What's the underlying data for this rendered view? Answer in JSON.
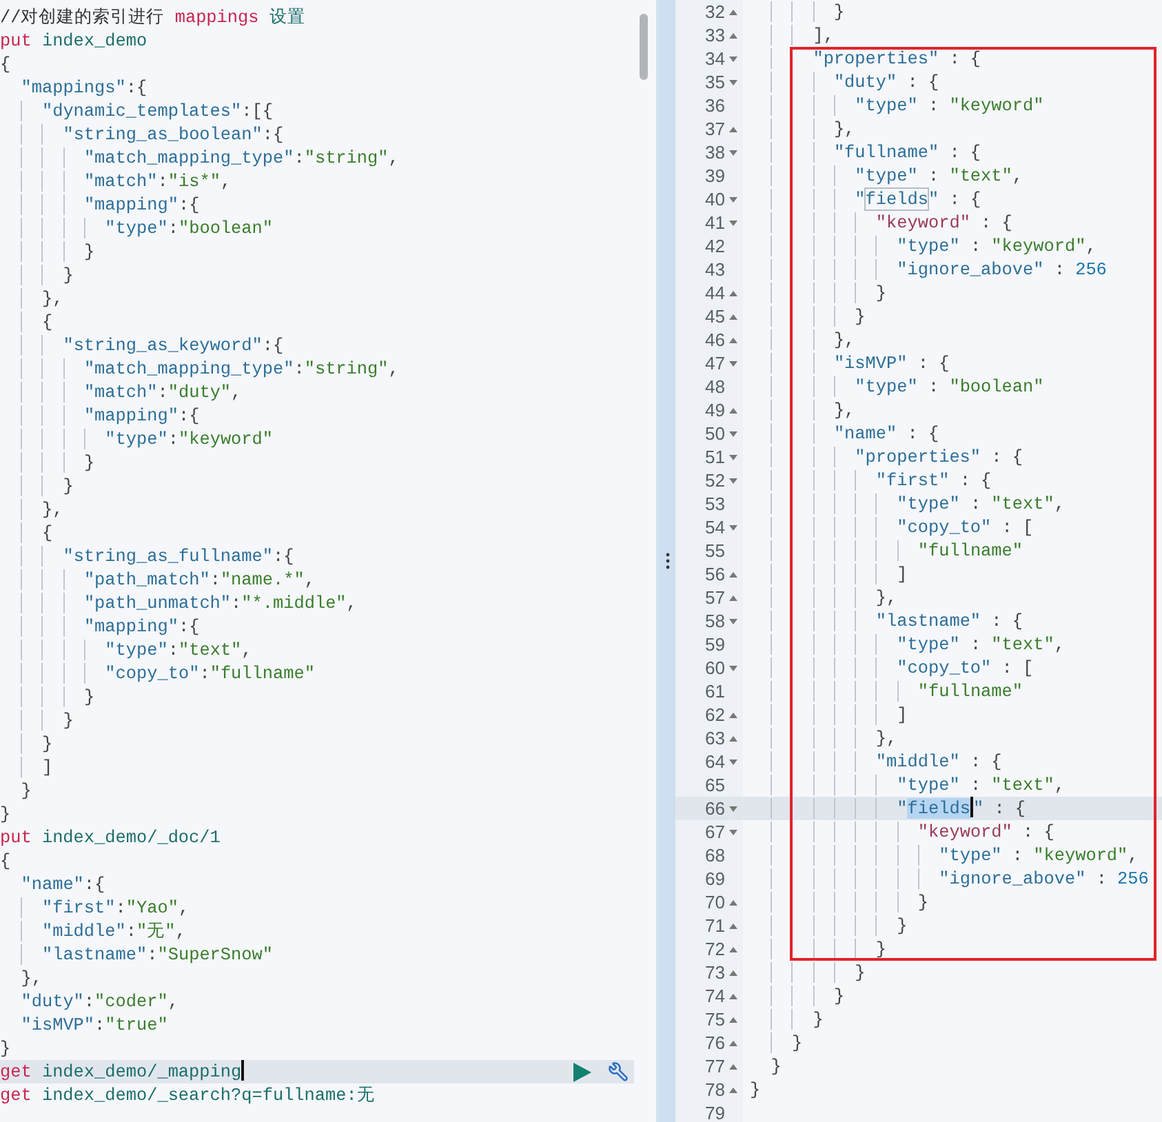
{
  "request_editor": {
    "lines": [
      {
        "active": false,
        "tokens": [
          {
            "kind": "comment",
            "text": "//对创建的索引进行 "
          },
          {
            "kind": "method",
            "text": "mappings"
          },
          {
            "kind": "path",
            "text": " 设置"
          }
        ]
      },
      {
        "active": false,
        "tokens": [
          {
            "kind": "method",
            "text": "put"
          },
          {
            "kind": "path",
            "text": " index_demo"
          }
        ]
      },
      {
        "active": false,
        "tokens": [
          {
            "kind": "punct",
            "text": "{"
          }
        ]
      },
      {
        "active": false,
        "tokens": [
          {
            "kind": "key",
            "text": "  \"mappings\""
          },
          {
            "kind": "punct",
            "text": ":{"
          }
        ]
      },
      {
        "active": false,
        "tokens": [
          {
            "kind": "key",
            "text": "    \"dynamic_templates\""
          },
          {
            "kind": "punct",
            "text": ":[{"
          }
        ]
      },
      {
        "active": false,
        "tokens": [
          {
            "kind": "key",
            "text": "      \"string_as_boolean\""
          },
          {
            "kind": "punct",
            "text": ":{"
          }
        ]
      },
      {
        "active": false,
        "tokens": [
          {
            "kind": "key",
            "text": "        \"match_mapping_type\""
          },
          {
            "kind": "punct",
            "text": ":"
          },
          {
            "kind": "string",
            "text": "\"string\""
          },
          {
            "kind": "punct",
            "text": ","
          }
        ]
      },
      {
        "active": false,
        "tokens": [
          {
            "kind": "key",
            "text": "        \"match\""
          },
          {
            "kind": "punct",
            "text": ":"
          },
          {
            "kind": "string",
            "text": "\"is*\""
          },
          {
            "kind": "punct",
            "text": ","
          }
        ]
      },
      {
        "active": false,
        "tokens": [
          {
            "kind": "key",
            "text": "        \"mapping\""
          },
          {
            "kind": "punct",
            "text": ":{"
          }
        ]
      },
      {
        "active": false,
        "tokens": [
          {
            "kind": "key",
            "text": "          \"type\""
          },
          {
            "kind": "punct",
            "text": ":"
          },
          {
            "kind": "string",
            "text": "\"boolean\""
          }
        ]
      },
      {
        "active": false,
        "tokens": [
          {
            "kind": "punct",
            "text": "        }"
          }
        ]
      },
      {
        "active": false,
        "tokens": [
          {
            "kind": "punct",
            "text": "      }"
          }
        ]
      },
      {
        "active": false,
        "tokens": [
          {
            "kind": "punct",
            "text": "    },"
          }
        ]
      },
      {
        "active": false,
        "tokens": [
          {
            "kind": "punct",
            "text": "    {"
          }
        ]
      },
      {
        "active": false,
        "tokens": [
          {
            "kind": "key",
            "text": "      \"string_as_keyword\""
          },
          {
            "kind": "punct",
            "text": ":{"
          }
        ]
      },
      {
        "active": false,
        "tokens": [
          {
            "kind": "key",
            "text": "        \"match_mapping_type\""
          },
          {
            "kind": "punct",
            "text": ":"
          },
          {
            "kind": "string",
            "text": "\"string\""
          },
          {
            "kind": "punct",
            "text": ","
          }
        ]
      },
      {
        "active": false,
        "tokens": [
          {
            "kind": "key",
            "text": "        \"match\""
          },
          {
            "kind": "punct",
            "text": ":"
          },
          {
            "kind": "string",
            "text": "\"duty\""
          },
          {
            "kind": "punct",
            "text": ","
          }
        ]
      },
      {
        "active": false,
        "tokens": [
          {
            "kind": "key",
            "text": "        \"mapping\""
          },
          {
            "kind": "punct",
            "text": ":{"
          }
        ]
      },
      {
        "active": false,
        "tokens": [
          {
            "kind": "key",
            "text": "          \"type\""
          },
          {
            "kind": "punct",
            "text": ":"
          },
          {
            "kind": "string",
            "text": "\"keyword\""
          }
        ]
      },
      {
        "active": false,
        "tokens": [
          {
            "kind": "punct",
            "text": "        }"
          }
        ]
      },
      {
        "active": false,
        "tokens": [
          {
            "kind": "punct",
            "text": "      }"
          }
        ]
      },
      {
        "active": false,
        "tokens": [
          {
            "kind": "punct",
            "text": "    },"
          }
        ]
      },
      {
        "active": false,
        "tokens": [
          {
            "kind": "punct",
            "text": "    {"
          }
        ]
      },
      {
        "active": false,
        "tokens": [
          {
            "kind": "key",
            "text": "      \"string_as_fullname\""
          },
          {
            "kind": "punct",
            "text": ":{"
          }
        ]
      },
      {
        "active": false,
        "tokens": [
          {
            "kind": "key",
            "text": "        \"path_match\""
          },
          {
            "kind": "punct",
            "text": ":"
          },
          {
            "kind": "string",
            "text": "\"name.*\""
          },
          {
            "kind": "punct",
            "text": ","
          }
        ]
      },
      {
        "active": false,
        "tokens": [
          {
            "kind": "key",
            "text": "        \"path_unmatch\""
          },
          {
            "kind": "punct",
            "text": ":"
          },
          {
            "kind": "string",
            "text": "\"*.middle\""
          },
          {
            "kind": "punct",
            "text": ","
          }
        ]
      },
      {
        "active": false,
        "tokens": [
          {
            "kind": "key",
            "text": "        \"mapping\""
          },
          {
            "kind": "punct",
            "text": ":{"
          }
        ]
      },
      {
        "active": false,
        "tokens": [
          {
            "kind": "key",
            "text": "          \"type\""
          },
          {
            "kind": "punct",
            "text": ":"
          },
          {
            "kind": "string",
            "text": "\"text\""
          },
          {
            "kind": "punct",
            "text": ","
          }
        ]
      },
      {
        "active": false,
        "tokens": [
          {
            "kind": "key",
            "text": "          \"copy_to\""
          },
          {
            "kind": "punct",
            "text": ":"
          },
          {
            "kind": "string",
            "text": "\"fullname\""
          }
        ]
      },
      {
        "active": false,
        "tokens": [
          {
            "kind": "punct",
            "text": "        }"
          }
        ]
      },
      {
        "active": false,
        "tokens": [
          {
            "kind": "punct",
            "text": "      }"
          }
        ]
      },
      {
        "active": false,
        "tokens": [
          {
            "kind": "punct",
            "text": "    }"
          }
        ]
      },
      {
        "active": false,
        "tokens": [
          {
            "kind": "punct",
            "text": "    ]"
          }
        ]
      },
      {
        "active": false,
        "tokens": [
          {
            "kind": "punct",
            "text": "  }"
          }
        ]
      },
      {
        "active": false,
        "tokens": [
          {
            "kind": "punct",
            "text": "}"
          }
        ]
      },
      {
        "active": false,
        "tokens": [
          {
            "kind": "method",
            "text": "put"
          },
          {
            "kind": "path",
            "text": " index_demo/_doc/1"
          }
        ]
      },
      {
        "active": false,
        "tokens": [
          {
            "kind": "punct",
            "text": "{"
          }
        ]
      },
      {
        "active": false,
        "tokens": [
          {
            "kind": "key",
            "text": "  \"name\""
          },
          {
            "kind": "punct",
            "text": ":{"
          }
        ]
      },
      {
        "active": false,
        "tokens": [
          {
            "kind": "key",
            "text": "    \"first\""
          },
          {
            "kind": "punct",
            "text": ":"
          },
          {
            "kind": "string",
            "text": "\"Yao\""
          },
          {
            "kind": "punct",
            "text": ","
          }
        ]
      },
      {
        "active": false,
        "tokens": [
          {
            "kind": "key",
            "text": "    \"middle\""
          },
          {
            "kind": "punct",
            "text": ":"
          },
          {
            "kind": "string",
            "text": "\"无\""
          },
          {
            "kind": "punct",
            "text": ","
          }
        ]
      },
      {
        "active": false,
        "tokens": [
          {
            "kind": "key",
            "text": "    \"lastname\""
          },
          {
            "kind": "punct",
            "text": ":"
          },
          {
            "kind": "string",
            "text": "\"SuperSnow\""
          }
        ]
      },
      {
        "active": false,
        "tokens": [
          {
            "kind": "punct",
            "text": "  },"
          }
        ]
      },
      {
        "active": false,
        "tokens": [
          {
            "kind": "key",
            "text": "  \"duty\""
          },
          {
            "kind": "punct",
            "text": ":"
          },
          {
            "kind": "string",
            "text": "\"coder\""
          },
          {
            "kind": "punct",
            "text": ","
          }
        ]
      },
      {
        "active": false,
        "tokens": [
          {
            "kind": "key",
            "text": "  \"isMVP\""
          },
          {
            "kind": "punct",
            "text": ":"
          },
          {
            "kind": "string",
            "text": "\"true\""
          }
        ]
      },
      {
        "active": false,
        "tokens": [
          {
            "kind": "punct",
            "text": "}"
          }
        ]
      },
      {
        "active": true,
        "tokens": [
          {
            "kind": "method",
            "text": "get"
          },
          {
            "kind": "path",
            "text": " index_demo/_mapping"
          }
        ]
      },
      {
        "active": false,
        "tokens": [
          {
            "kind": "method",
            "text": "get"
          },
          {
            "kind": "path",
            "text": " index_demo/_search?q=fullname:无"
          }
        ]
      }
    ]
  },
  "response_editor": {
    "lines": [
      {
        "number": "32",
        "fold_start": false,
        "fold_end": true,
        "active": false,
        "tokens": [
          {
            "kind": "punct",
            "text": "        }"
          }
        ]
      },
      {
        "number": "33",
        "fold_start": false,
        "fold_end": true,
        "active": false,
        "tokens": [
          {
            "kind": "punct",
            "text": "      ],"
          }
        ]
      },
      {
        "number": "34",
        "fold_start": true,
        "fold_end": false,
        "active": false,
        "tokens": [
          {
            "kind": "key",
            "text": "      \"properties\""
          },
          {
            "kind": "punct",
            "text": " : {"
          }
        ]
      },
      {
        "number": "35",
        "fold_start": true,
        "fold_end": false,
        "active": false,
        "tokens": [
          {
            "kind": "key",
            "text": "        \"duty\""
          },
          {
            "kind": "punct",
            "text": " : {"
          }
        ]
      },
      {
        "number": "36",
        "fold_start": false,
        "fold_end": false,
        "active": false,
        "tokens": [
          {
            "kind": "key",
            "text": "          \"type\""
          },
          {
            "kind": "punct",
            "text": " : "
          },
          {
            "kind": "string",
            "text": "\"keyword\""
          }
        ]
      },
      {
        "number": "37",
        "fold_start": false,
        "fold_end": true,
        "active": false,
        "tokens": [
          {
            "kind": "punct",
            "text": "        },"
          }
        ]
      },
      {
        "number": "38",
        "fold_start": true,
        "fold_end": false,
        "active": false,
        "tokens": [
          {
            "kind": "key",
            "text": "        \"fullname\""
          },
          {
            "kind": "punct",
            "text": " : {"
          }
        ]
      },
      {
        "number": "39",
        "fold_start": false,
        "fold_end": false,
        "active": false,
        "tokens": [
          {
            "kind": "key",
            "text": "          \"type\""
          },
          {
            "kind": "punct",
            "text": " : "
          },
          {
            "kind": "string",
            "text": "\"text\""
          },
          {
            "kind": "punct",
            "text": ","
          }
        ]
      },
      {
        "number": "40",
        "fold_start": true,
        "fold_end": false,
        "active": false,
        "tokens": [
          {
            "kind": "key",
            "text": "          \""
          },
          {
            "kind": "occurrence",
            "text": "fields"
          },
          {
            "kind": "key",
            "text": "\""
          },
          {
            "kind": "punct",
            "text": " : {"
          }
        ]
      },
      {
        "number": "41",
        "fold_start": true,
        "fold_end": false,
        "active": false,
        "tokens": [
          {
            "kind": "key2",
            "text": "            \"keyword\""
          },
          {
            "kind": "punct",
            "text": " : {"
          }
        ]
      },
      {
        "number": "42",
        "fold_start": false,
        "fold_end": false,
        "active": false,
        "tokens": [
          {
            "kind": "key",
            "text": "              \"type\""
          },
          {
            "kind": "punct",
            "text": " : "
          },
          {
            "kind": "string",
            "text": "\"keyword\""
          },
          {
            "kind": "punct",
            "text": ","
          }
        ]
      },
      {
        "number": "43",
        "fold_start": false,
        "fold_end": false,
        "active": false,
        "tokens": [
          {
            "kind": "key",
            "text": "              \"ignore_above\""
          },
          {
            "kind": "punct",
            "text": " : "
          },
          {
            "kind": "number",
            "text": "256"
          }
        ]
      },
      {
        "number": "44",
        "fold_start": false,
        "fold_end": true,
        "active": false,
        "tokens": [
          {
            "kind": "punct",
            "text": "            }"
          }
        ]
      },
      {
        "number": "45",
        "fold_start": false,
        "fold_end": true,
        "active": false,
        "tokens": [
          {
            "kind": "punct",
            "text": "          }"
          }
        ]
      },
      {
        "number": "46",
        "fold_start": false,
        "fold_end": true,
        "active": false,
        "tokens": [
          {
            "kind": "punct",
            "text": "        },"
          }
        ]
      },
      {
        "number": "47",
        "fold_start": true,
        "fold_end": false,
        "active": false,
        "tokens": [
          {
            "kind": "key",
            "text": "        \"isMVP\""
          },
          {
            "kind": "punct",
            "text": " : {"
          }
        ]
      },
      {
        "number": "48",
        "fold_start": false,
        "fold_end": false,
        "active": false,
        "tokens": [
          {
            "kind": "key",
            "text": "          \"type\""
          },
          {
            "kind": "punct",
            "text": " : "
          },
          {
            "kind": "string",
            "text": "\"boolean\""
          }
        ]
      },
      {
        "number": "49",
        "fold_start": false,
        "fold_end": true,
        "active": false,
        "tokens": [
          {
            "kind": "punct",
            "text": "        },"
          }
        ]
      },
      {
        "number": "50",
        "fold_start": true,
        "fold_end": false,
        "active": false,
        "tokens": [
          {
            "kind": "key",
            "text": "        \"name\""
          },
          {
            "kind": "punct",
            "text": " : {"
          }
        ]
      },
      {
        "number": "51",
        "fold_start": true,
        "fold_end": false,
        "active": false,
        "tokens": [
          {
            "kind": "key",
            "text": "          \"properties\""
          },
          {
            "kind": "punct",
            "text": " : {"
          }
        ]
      },
      {
        "number": "52",
        "fold_start": true,
        "fold_end": false,
        "active": false,
        "tokens": [
          {
            "kind": "key",
            "text": "            \"first\""
          },
          {
            "kind": "punct",
            "text": " : {"
          }
        ]
      },
      {
        "number": "53",
        "fold_start": false,
        "fold_end": false,
        "active": false,
        "tokens": [
          {
            "kind": "key",
            "text": "              \"type\""
          },
          {
            "kind": "punct",
            "text": " : "
          },
          {
            "kind": "string",
            "text": "\"text\""
          },
          {
            "kind": "punct",
            "text": ","
          }
        ]
      },
      {
        "number": "54",
        "fold_start": true,
        "fold_end": false,
        "active": false,
        "tokens": [
          {
            "kind": "key",
            "text": "              \"copy_to\""
          },
          {
            "kind": "punct",
            "text": " : ["
          }
        ]
      },
      {
        "number": "55",
        "fold_start": false,
        "fold_end": false,
        "active": false,
        "tokens": [
          {
            "kind": "string",
            "text": "                \"fullname\""
          }
        ]
      },
      {
        "number": "56",
        "fold_start": false,
        "fold_end": true,
        "active": false,
        "tokens": [
          {
            "kind": "punct",
            "text": "              ]"
          }
        ]
      },
      {
        "number": "57",
        "fold_start": false,
        "fold_end": true,
        "active": false,
        "tokens": [
          {
            "kind": "punct",
            "text": "            },"
          }
        ]
      },
      {
        "number": "58",
        "fold_start": true,
        "fold_end": false,
        "active": false,
        "tokens": [
          {
            "kind": "key",
            "text": "            \"lastname\""
          },
          {
            "kind": "punct",
            "text": " : {"
          }
        ]
      },
      {
        "number": "59",
        "fold_start": false,
        "fold_end": false,
        "active": false,
        "tokens": [
          {
            "kind": "key",
            "text": "              \"type\""
          },
          {
            "kind": "punct",
            "text": " : "
          },
          {
            "kind": "string",
            "text": "\"text\""
          },
          {
            "kind": "punct",
            "text": ","
          }
        ]
      },
      {
        "number": "60",
        "fold_start": true,
        "fold_end": false,
        "active": false,
        "tokens": [
          {
            "kind": "key",
            "text": "              \"copy_to\""
          },
          {
            "kind": "punct",
            "text": " : ["
          }
        ]
      },
      {
        "number": "61",
        "fold_start": false,
        "fold_end": false,
        "active": false,
        "tokens": [
          {
            "kind": "string",
            "text": "                \"fullname\""
          }
        ]
      },
      {
        "number": "62",
        "fold_start": false,
        "fold_end": true,
        "active": false,
        "tokens": [
          {
            "kind": "punct",
            "text": "              ]"
          }
        ]
      },
      {
        "number": "63",
        "fold_start": false,
        "fold_end": true,
        "active": false,
        "tokens": [
          {
            "kind": "punct",
            "text": "            },"
          }
        ]
      },
      {
        "number": "64",
        "fold_start": true,
        "fold_end": false,
        "active": false,
        "tokens": [
          {
            "kind": "key",
            "text": "            \"middle\""
          },
          {
            "kind": "punct",
            "text": " : {"
          }
        ]
      },
      {
        "number": "65",
        "fold_start": false,
        "fold_end": false,
        "active": false,
        "tokens": [
          {
            "kind": "key",
            "text": "              \"type\""
          },
          {
            "kind": "punct",
            "text": " : "
          },
          {
            "kind": "string",
            "text": "\"text\""
          },
          {
            "kind": "punct",
            "text": ","
          }
        ]
      },
      {
        "number": "66",
        "fold_start": true,
        "fold_end": false,
        "active": true,
        "tokens": [
          {
            "kind": "key",
            "text": "              \""
          },
          {
            "kind": "selection",
            "text": "fields"
          },
          {
            "kind": "key",
            "text": "\""
          },
          {
            "kind": "punct",
            "text": " : {"
          }
        ]
      },
      {
        "number": "67",
        "fold_start": true,
        "fold_end": false,
        "active": false,
        "tokens": [
          {
            "kind": "key2",
            "text": "                \"keyword\""
          },
          {
            "kind": "punct",
            "text": " : {"
          }
        ]
      },
      {
        "number": "68",
        "fold_start": false,
        "fold_end": false,
        "active": false,
        "tokens": [
          {
            "kind": "key",
            "text": "                  \"type\""
          },
          {
            "kind": "punct",
            "text": " : "
          },
          {
            "kind": "string",
            "text": "\"keyword\""
          },
          {
            "kind": "punct",
            "text": ","
          }
        ]
      },
      {
        "number": "69",
        "fold_start": false,
        "fold_end": false,
        "active": false,
        "tokens": [
          {
            "kind": "key",
            "text": "                  \"ignore_above\""
          },
          {
            "kind": "punct",
            "text": " : "
          },
          {
            "kind": "number",
            "text": "256"
          }
        ]
      },
      {
        "number": "70",
        "fold_start": false,
        "fold_end": true,
        "active": false,
        "tokens": [
          {
            "kind": "punct",
            "text": "                }"
          }
        ]
      },
      {
        "number": "71",
        "fold_start": false,
        "fold_end": true,
        "active": false,
        "tokens": [
          {
            "kind": "punct",
            "text": "              }"
          }
        ]
      },
      {
        "number": "72",
        "fold_start": false,
        "fold_end": true,
        "active": false,
        "tokens": [
          {
            "kind": "punct",
            "text": "            }"
          }
        ]
      },
      {
        "number": "73",
        "fold_start": false,
        "fold_end": true,
        "active": false,
        "tokens": [
          {
            "kind": "punct",
            "text": "          }"
          }
        ]
      },
      {
        "number": "74",
        "fold_start": false,
        "fold_end": true,
        "active": false,
        "tokens": [
          {
            "kind": "punct",
            "text": "        }"
          }
        ]
      },
      {
        "number": "75",
        "fold_start": false,
        "fold_end": true,
        "active": false,
        "tokens": [
          {
            "kind": "punct",
            "text": "      }"
          }
        ]
      },
      {
        "number": "76",
        "fold_start": false,
        "fold_end": true,
        "active": false,
        "tokens": [
          {
            "kind": "punct",
            "text": "    }"
          }
        ]
      },
      {
        "number": "77",
        "fold_start": false,
        "fold_end": true,
        "active": false,
        "tokens": [
          {
            "kind": "punct",
            "text": "  }"
          }
        ]
      },
      {
        "number": "78",
        "fold_start": false,
        "fold_end": true,
        "active": false,
        "tokens": [
          {
            "kind": "punct",
            "text": "}"
          }
        ]
      },
      {
        "number": "79",
        "fold_start": false,
        "fold_end": false,
        "active": false
      }
    ]
  }
}
